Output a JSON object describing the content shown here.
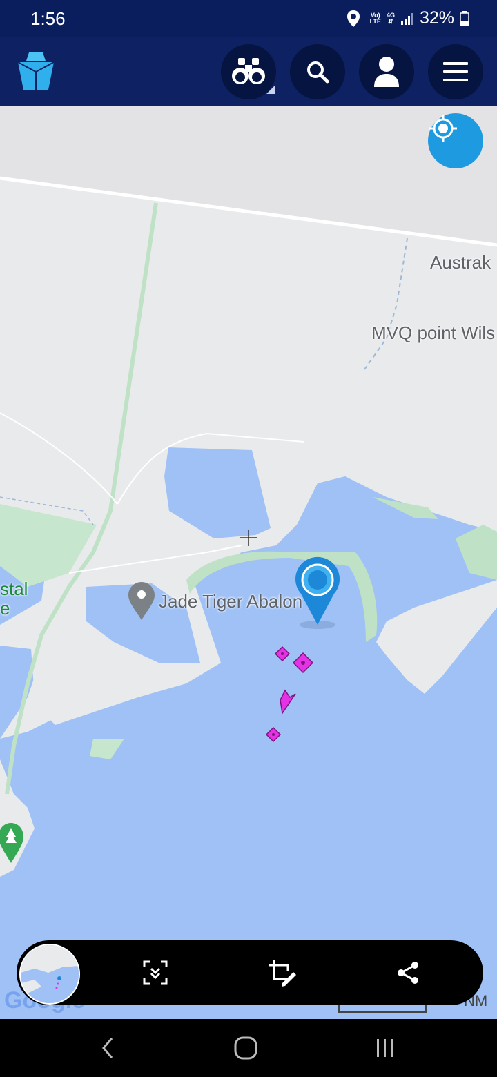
{
  "status": {
    "time": "1:56",
    "network_top": "Vo)",
    "network_bottom": "LTE",
    "gen_top": "4G",
    "battery": "32%"
  },
  "header": {
    "logo_icon": "ship-logo-icon",
    "buttons": [
      {
        "name": "binoculars-button",
        "icon": "binoculars-icon"
      },
      {
        "name": "search-button",
        "icon": "search-icon"
      },
      {
        "name": "account-button",
        "icon": "user-icon"
      },
      {
        "name": "menu-button",
        "icon": "hamburger-menu-icon"
      }
    ]
  },
  "map": {
    "labels": {
      "austrak": "Austrak",
      "mvq": "MVQ point Wils",
      "jade": "Jade Tiger Abalon",
      "coastal_line1": "stal",
      "coastal_line2": "e"
    },
    "vessels": [
      "diamond-vessel-icon",
      "diamond-vessel-icon",
      "arrow-vessel-icon",
      "diamond-vessel-icon"
    ],
    "colors": {
      "water": "#9fc1f6",
      "land": "#e9eaec",
      "park": "#bfe2c6",
      "vessel": "#e632e6",
      "pin": "#1e88d8"
    }
  },
  "toolbar": {
    "icons": [
      "scroll-capture-icon",
      "crop-edit-icon",
      "share-icon"
    ]
  },
  "attribution": {
    "google": "Google",
    "scale_unit": "NM"
  },
  "navbar": {
    "icons": [
      "back-icon",
      "home-icon",
      "recent-apps-icon"
    ]
  }
}
